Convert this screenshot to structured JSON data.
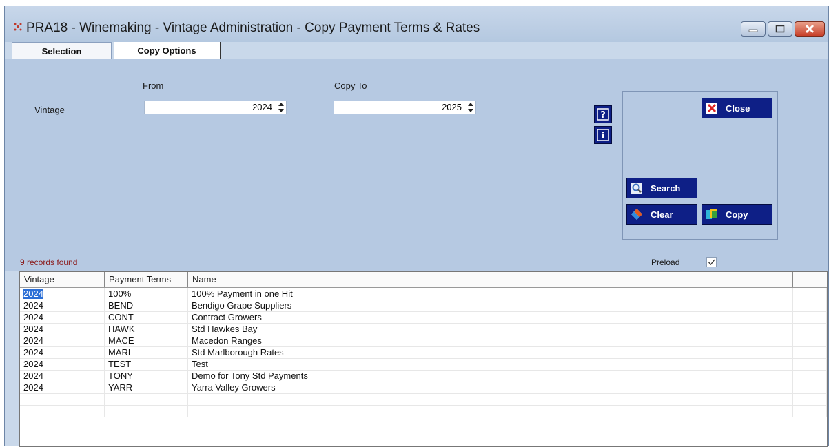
{
  "window": {
    "title": "PRA18 - Winemaking - Vintage Administration - Copy Payment Terms & Rates"
  },
  "tabs": [
    {
      "label": "Selection",
      "selected": true
    },
    {
      "label": "Copy Options",
      "selected": false
    }
  ],
  "form": {
    "vintage_label": "Vintage",
    "from_label": "From",
    "copy_to_label": "Copy To",
    "from_value": "2024",
    "copy_to_value": "2025"
  },
  "buttons": {
    "close": "Close",
    "search": "Search",
    "clear": "Clear",
    "copy": "Copy"
  },
  "status": {
    "records_found": "9 records found",
    "preload_label": "Preload",
    "preload_checked": true
  },
  "grid": {
    "columns": [
      "Vintage",
      "Payment Terms",
      "Name"
    ],
    "rows": [
      [
        "2024",
        "100%",
        "100% Payment in one Hit"
      ],
      [
        "2024",
        "BEND",
        "Bendigo Grape Suppliers"
      ],
      [
        "2024",
        "CONT",
        "Contract Growers"
      ],
      [
        "2024",
        "HAWK",
        "Std Hawkes Bay"
      ],
      [
        "2024",
        "MACE",
        "Macedon Ranges"
      ],
      [
        "2024",
        "MARL",
        "Std Marlborough Rates"
      ],
      [
        "2024",
        "TEST",
        "Test"
      ],
      [
        "2024",
        "TONY",
        "Demo for Tony Std Payments"
      ],
      [
        "2024",
        "YARR",
        "Yarra Valley Growers"
      ]
    ]
  },
  "colors": {
    "button_bg": "#0e1f86",
    "panel_bg": "#b6c9e2",
    "records_text": "#8b1a1a",
    "selection": "#2c6fd6"
  }
}
